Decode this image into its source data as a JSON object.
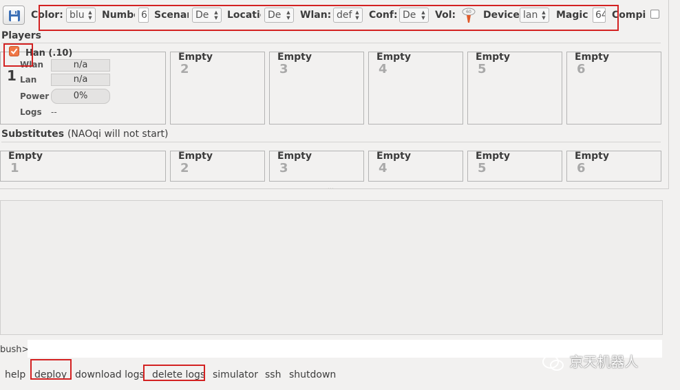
{
  "toolbar": {
    "color_label": "Color:",
    "color_value": "blu",
    "number_label": "Numbe",
    "number_value": "6",
    "scenario_label": "Scenar",
    "scenario_value": "De",
    "location_label": "Locatio",
    "location_value": "De",
    "wlan_label": "Wlan:",
    "wlan_value": "def",
    "conf_label": "Conf:",
    "conf_value": "De",
    "vol_label": "Vol:",
    "device_label": "Device",
    "device_value": "lan",
    "magic_label": "Magic",
    "magic_value": "64",
    "compile_label": "Compil"
  },
  "players": {
    "title": "Players",
    "robot": {
      "name": "Han (.10)",
      "number": "1",
      "checked": true,
      "wlan_label": "Wlan",
      "wlan_value": "n/a",
      "lan_label": "Lan",
      "lan_value": "n/a",
      "power_label": "Power",
      "power_value": "0%",
      "logs_label": "Logs",
      "logs_value": "--"
    },
    "slots": [
      {
        "title": "Empty",
        "number": "2"
      },
      {
        "title": "Empty",
        "number": "3"
      },
      {
        "title": "Empty",
        "number": "4"
      },
      {
        "title": "Empty",
        "number": "5"
      },
      {
        "title": "Empty",
        "number": "6"
      }
    ]
  },
  "substitutes": {
    "title": "Substitutes",
    "note": "(NAOqi will not start)",
    "slots": [
      {
        "title": "Empty",
        "number": "1"
      },
      {
        "title": "Empty",
        "number": "2"
      },
      {
        "title": "Empty",
        "number": "3"
      },
      {
        "title": "Empty",
        "number": "4"
      },
      {
        "title": "Empty",
        "number": "5"
      },
      {
        "title": "Empty",
        "number": "6"
      }
    ]
  },
  "console": {
    "prompt": "bush>",
    "input_value": ""
  },
  "bottom_nav": [
    "help",
    "deploy",
    "download logs",
    "delete logs",
    "simulator",
    "ssh",
    "shutdown"
  ],
  "watermark": "京天机器人",
  "colors": {
    "highlight": "#d32020",
    "checkbox": "#f07746"
  }
}
